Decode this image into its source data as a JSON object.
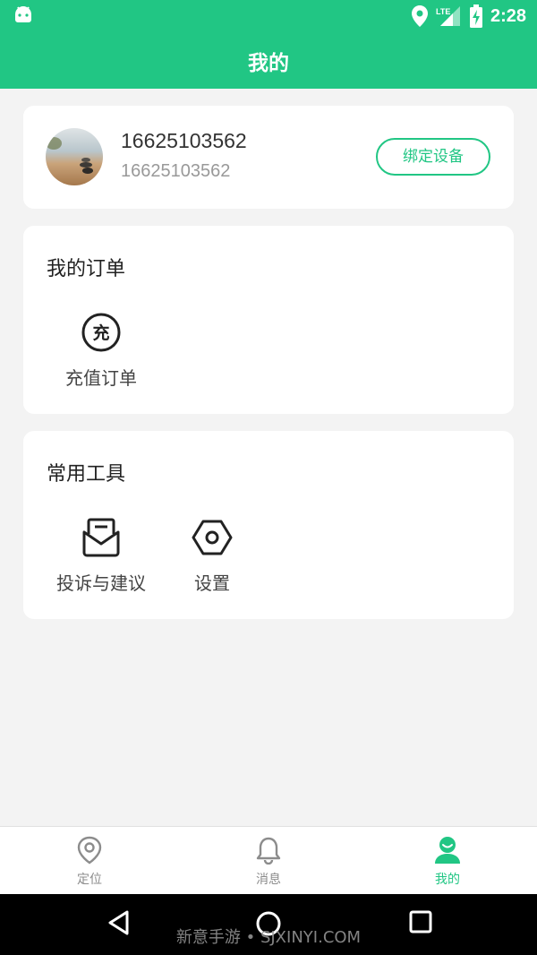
{
  "status_bar": {
    "time": "2:28",
    "network": "LTE",
    "icons": [
      "android-icon",
      "location-icon",
      "signal-icon",
      "battery-charging-icon"
    ]
  },
  "header": {
    "title": "我的"
  },
  "profile": {
    "phone": "16625103562",
    "account": "16625103562",
    "bind_button": "绑定设备"
  },
  "orders": {
    "title": "我的订单",
    "items": [
      {
        "label": "充值订单",
        "icon": "recharge-icon",
        "glyph": "充"
      }
    ]
  },
  "tools": {
    "title": "常用工具",
    "items": [
      {
        "label": "投诉与建议",
        "icon": "mail-icon"
      },
      {
        "label": "设置",
        "icon": "hexagon-settings-icon"
      }
    ]
  },
  "bottom_nav": {
    "items": [
      {
        "label": "定位",
        "icon": "location-pin-icon",
        "active": false
      },
      {
        "label": "消息",
        "icon": "bell-icon",
        "active": false
      },
      {
        "label": "我的",
        "icon": "user-icon",
        "active": true
      }
    ]
  },
  "system_nav": {
    "buttons": [
      "back-icon",
      "home-icon",
      "recents-icon"
    ]
  },
  "watermark": "新意手游 • SJXINYI.COM",
  "colors": {
    "accent": "#21c684",
    "background": "#f3f3f3",
    "card": "#ffffff"
  }
}
